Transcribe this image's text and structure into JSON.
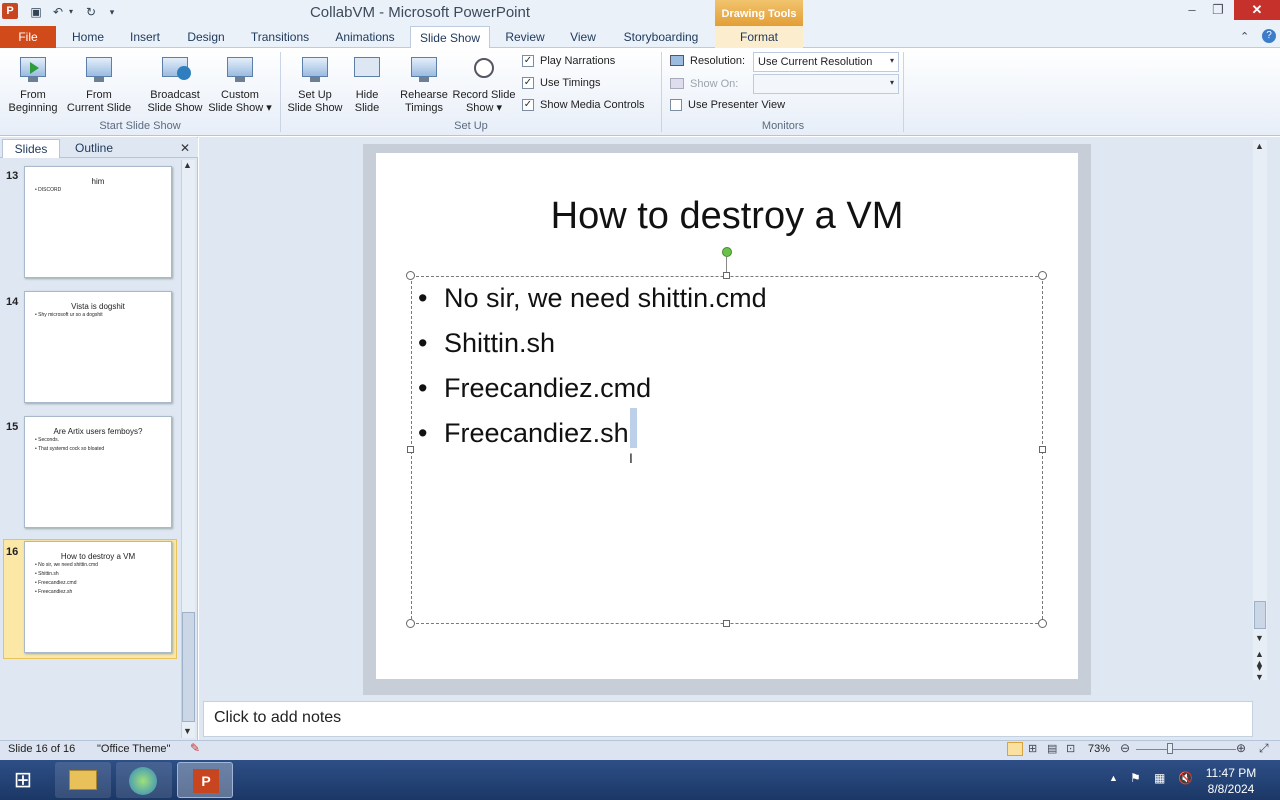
{
  "window": {
    "title": "CollabVM  -  Microsoft PowerPoint",
    "context_group": "Drawing Tools"
  },
  "tabs": [
    "File",
    "Home",
    "Insert",
    "Design",
    "Transitions",
    "Animations",
    "Slide Show",
    "Review",
    "View",
    "Storyboarding",
    "Format"
  ],
  "ribbon": {
    "start": {
      "from_beginning_1": "From",
      "from_beginning_2": "Beginning",
      "from_current_1": "From",
      "from_current_2": "Current Slide",
      "broadcast_1": "Broadcast",
      "broadcast_2": "Slide Show",
      "custom_1": "Custom",
      "custom_2": "Slide Show",
      "label": "Start Slide Show"
    },
    "setup": {
      "setup_1": "Set Up",
      "setup_2": "Slide Show",
      "hide_1": "Hide",
      "hide_2": "Slide",
      "rehearse_1": "Rehearse",
      "rehearse_2": "Timings",
      "record_1": "Record Slide",
      "record_2": "Show",
      "play_narrations": "Play Narrations",
      "use_timings": "Use Timings",
      "show_media_controls": "Show Media Controls",
      "label": "Set Up"
    },
    "monitors": {
      "resolution_label": "Resolution:",
      "resolution_value": "Use Current Resolution",
      "show_on_label": "Show On:",
      "show_on_value": "",
      "presenter_view": "Use Presenter View",
      "label": "Monitors"
    }
  },
  "pane": {
    "tab_slides": "Slides",
    "tab_outline": "Outline",
    "close": "✕"
  },
  "thumbnails": [
    {
      "num": "13",
      "title": "him",
      "lines": [
        "DISCORD"
      ]
    },
    {
      "num": "14",
      "title": "Vista is dogshit",
      "lines": [
        "Shy microsoft ur so a dogshit"
      ]
    },
    {
      "num": "15",
      "title": "Are Artix users femboys?",
      "lines": [
        "Seconds.",
        "That systemd cock so bloated"
      ]
    },
    {
      "num": "16",
      "title": "How to destroy a VM",
      "lines": [
        "No sir, we need shittin.cmd",
        "Shittin.sh",
        "Freecandiez.cmd",
        "Freecandiez.sh"
      ]
    }
  ],
  "slide": {
    "title": "How to destroy a VM",
    "bullets": [
      "No sir, we need shittin.cmd",
      "Shittin.sh",
      "Freecandiez.cmd",
      "Freecandiez.sh"
    ]
  },
  "notes": {
    "placeholder": "Click to add notes"
  },
  "status": {
    "slide_info": "Slide 16 of 16",
    "theme": "\"Office Theme\"",
    "zoom": "73%"
  },
  "taskbar": {
    "time": "11:47 PM",
    "date": "8/8/2024"
  }
}
